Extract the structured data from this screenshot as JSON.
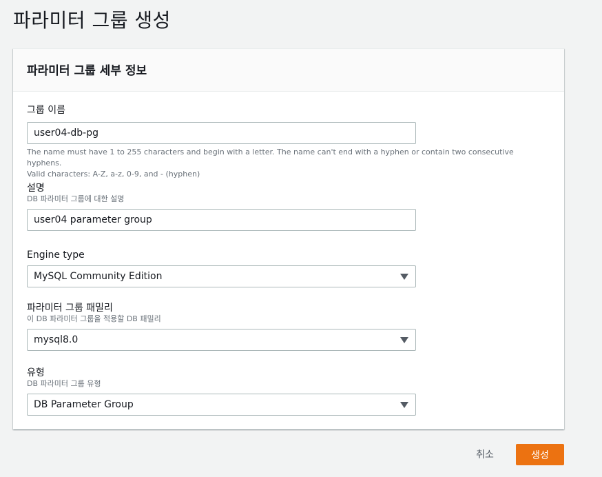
{
  "page": {
    "title": "파라미터 그룹 생성"
  },
  "panel": {
    "header": "파라미터 그룹 세부 정보"
  },
  "fields": {
    "group_name": {
      "label": "그룹 이름",
      "value": "user04-db-pg",
      "constraint_line1": "The name must have 1 to 255 characters and begin with a letter. The name can't end with a hyphen or contain two consecutive hyphens.",
      "constraint_line2": "Valid characters: A-Z, a-z, 0-9, and - (hyphen)"
    },
    "description": {
      "label": "설명",
      "desc": "DB 파라미터 그룹에 대한 설명",
      "value": "user04 parameter group"
    },
    "engine_type": {
      "label": "Engine type",
      "value": "MySQL Community Edition"
    },
    "family": {
      "label": "파라미터 그룹 패밀리",
      "desc": "이 DB 파라미터 그룹을 적용할 DB 패밀리",
      "value": "mysql8.0"
    },
    "type": {
      "label": "유형",
      "desc": "DB 파라미터 그룹 유형",
      "value": "DB Parameter Group"
    }
  },
  "actions": {
    "cancel": "취소",
    "create": "생성"
  },
  "colors": {
    "primary_button": "#ec7211",
    "background": "#f2f3f3"
  }
}
